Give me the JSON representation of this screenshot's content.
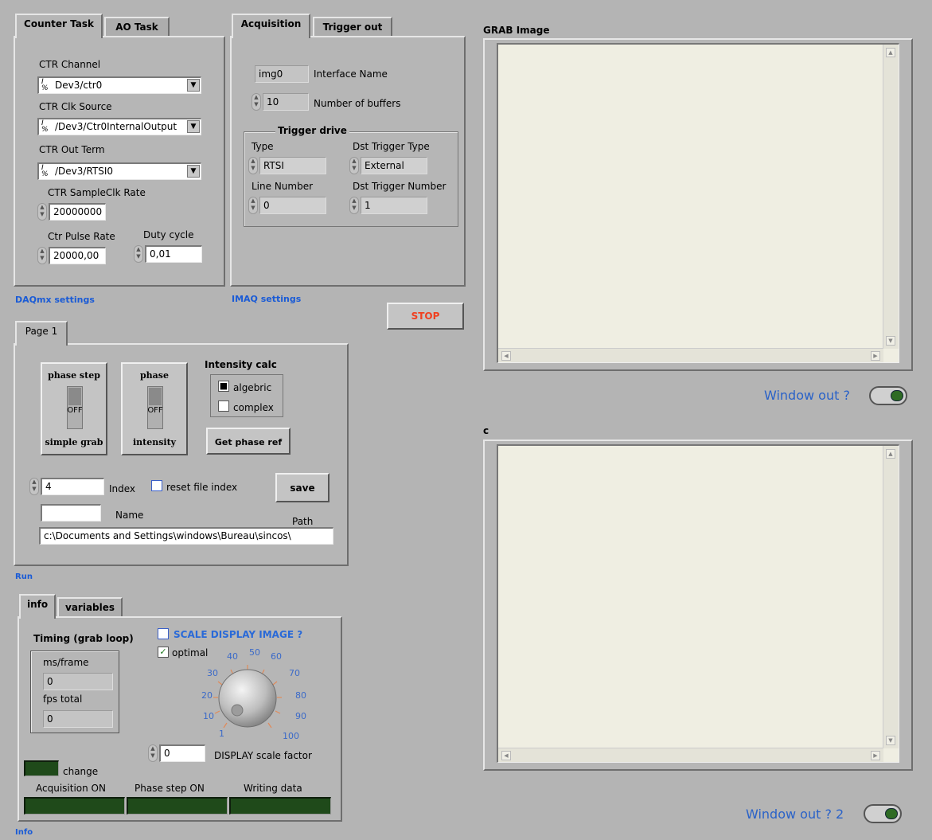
{
  "daqmx": {
    "tabs": [
      "Counter Task",
      "AO Task"
    ],
    "ctr_channel_label": "CTR Channel",
    "ctr_channel_value": "Dev3/ctr0",
    "ctr_clk_source_label": "CTR Clk Source",
    "ctr_clk_source_value": "/Dev3/Ctr0InternalOutput",
    "ctr_out_term_label": "CTR Out Term",
    "ctr_out_term_value": "/Dev3/RTSI0",
    "sampleclk_label": "CTR SampleClk Rate",
    "sampleclk_value": "20000000",
    "pulse_rate_label": "Ctr Pulse Rate",
    "pulse_rate_value": "20000,00",
    "duty_cycle_label": "Duty cycle",
    "duty_cycle_value": "0,01",
    "caption": "DAQmx settings"
  },
  "imaq": {
    "tabs": [
      "Acquisition",
      "Trigger out"
    ],
    "interface_value": "img0",
    "interface_label": "Interface Name",
    "buffers_value": "10",
    "buffers_label": "Number of buffers",
    "trigger_title": "Trigger drive",
    "type_label": "Type",
    "type_value": "RTSI",
    "dst_type_label": "Dst Trigger Type",
    "dst_type_value": "External",
    "line_label": "Line Number",
    "line_value": "0",
    "dst_number_label": "Dst Trigger Number",
    "dst_number_value": "1",
    "caption": "IMAQ settings"
  },
  "stop_label": "STOP",
  "run": {
    "tab": "Page 1",
    "phase_step_top": "phase step",
    "phase_step_bottom": "simple grab",
    "phase_top": "phase",
    "phase_bottom": "intensity",
    "switch_off": "OFF",
    "intensity_title": "Intensity calc",
    "algebric": "algebric",
    "complex": "complex",
    "get_phase_ref": "Get phase ref",
    "index_value": "4",
    "index_label": "Index",
    "reset_label": "reset file index",
    "save_label": "save",
    "name_label": "Name",
    "path_label": "Path",
    "path_value": "c:\\Documents and Settings\\windows\\Bureau\\sincos\\",
    "caption": "Run"
  },
  "info": {
    "tabs": [
      "info",
      "variables"
    ],
    "timing_title": "Timing (grab loop)",
    "ms_frame_label": "ms/frame",
    "ms_frame_value": "0",
    "fps_label": "fps total",
    "fps_value": "0",
    "scale_label": "SCALE DISPLAY IMAGE ?",
    "optimal_label": "optimal",
    "knob_ticks": [
      "1",
      "10",
      "20",
      "30",
      "40",
      "50",
      "60",
      "70",
      "80",
      "90",
      "100"
    ],
    "scale_value": "0",
    "scale_factor_label": "DISPLAY scale factor",
    "change_label": "change",
    "acq_on_label": "Acquisition ON",
    "phase_on_label": "Phase step ON",
    "writing_label": "Writing data",
    "caption": "Info"
  },
  "grab": {
    "title": "GRAB Image",
    "window_out": "Window out ?"
  },
  "c_display": {
    "title": "c",
    "window_out": "Window out ? 2"
  }
}
